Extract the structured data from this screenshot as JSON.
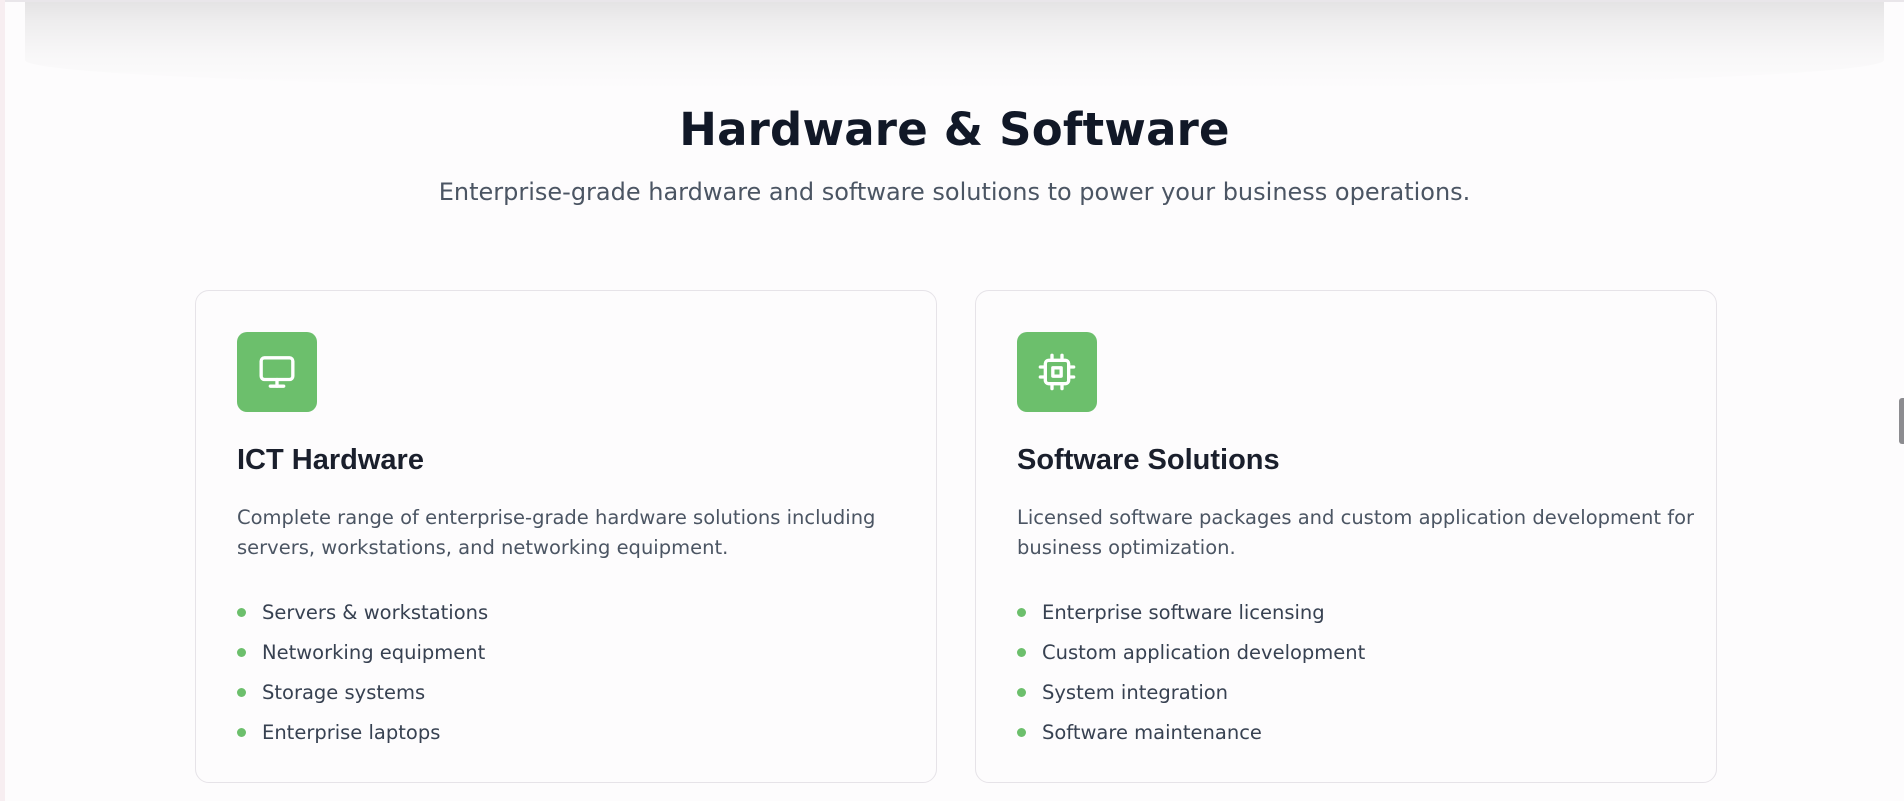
{
  "section": {
    "title": "Hardware & Software",
    "subtitle": "Enterprise-grade hardware and software solutions to power your business operations."
  },
  "colors": {
    "accent": "#6cbf6c",
    "title": "#111827",
    "body_text": "#4b5563"
  },
  "cards": [
    {
      "icon": "monitor-icon",
      "title": "ICT Hardware",
      "description": "Complete range of enterprise-grade hardware solutions including servers, workstations, and networking equipment.",
      "features": [
        "Servers & workstations",
        "Networking equipment",
        "Storage systems",
        "Enterprise laptops"
      ]
    },
    {
      "icon": "cpu-chip-icon",
      "title": "Software Solutions",
      "description": "Licensed software packages and custom application development for business optimization.",
      "features": [
        "Enterprise software licensing",
        "Custom application development",
        "System integration",
        "Software maintenance"
      ]
    }
  ]
}
